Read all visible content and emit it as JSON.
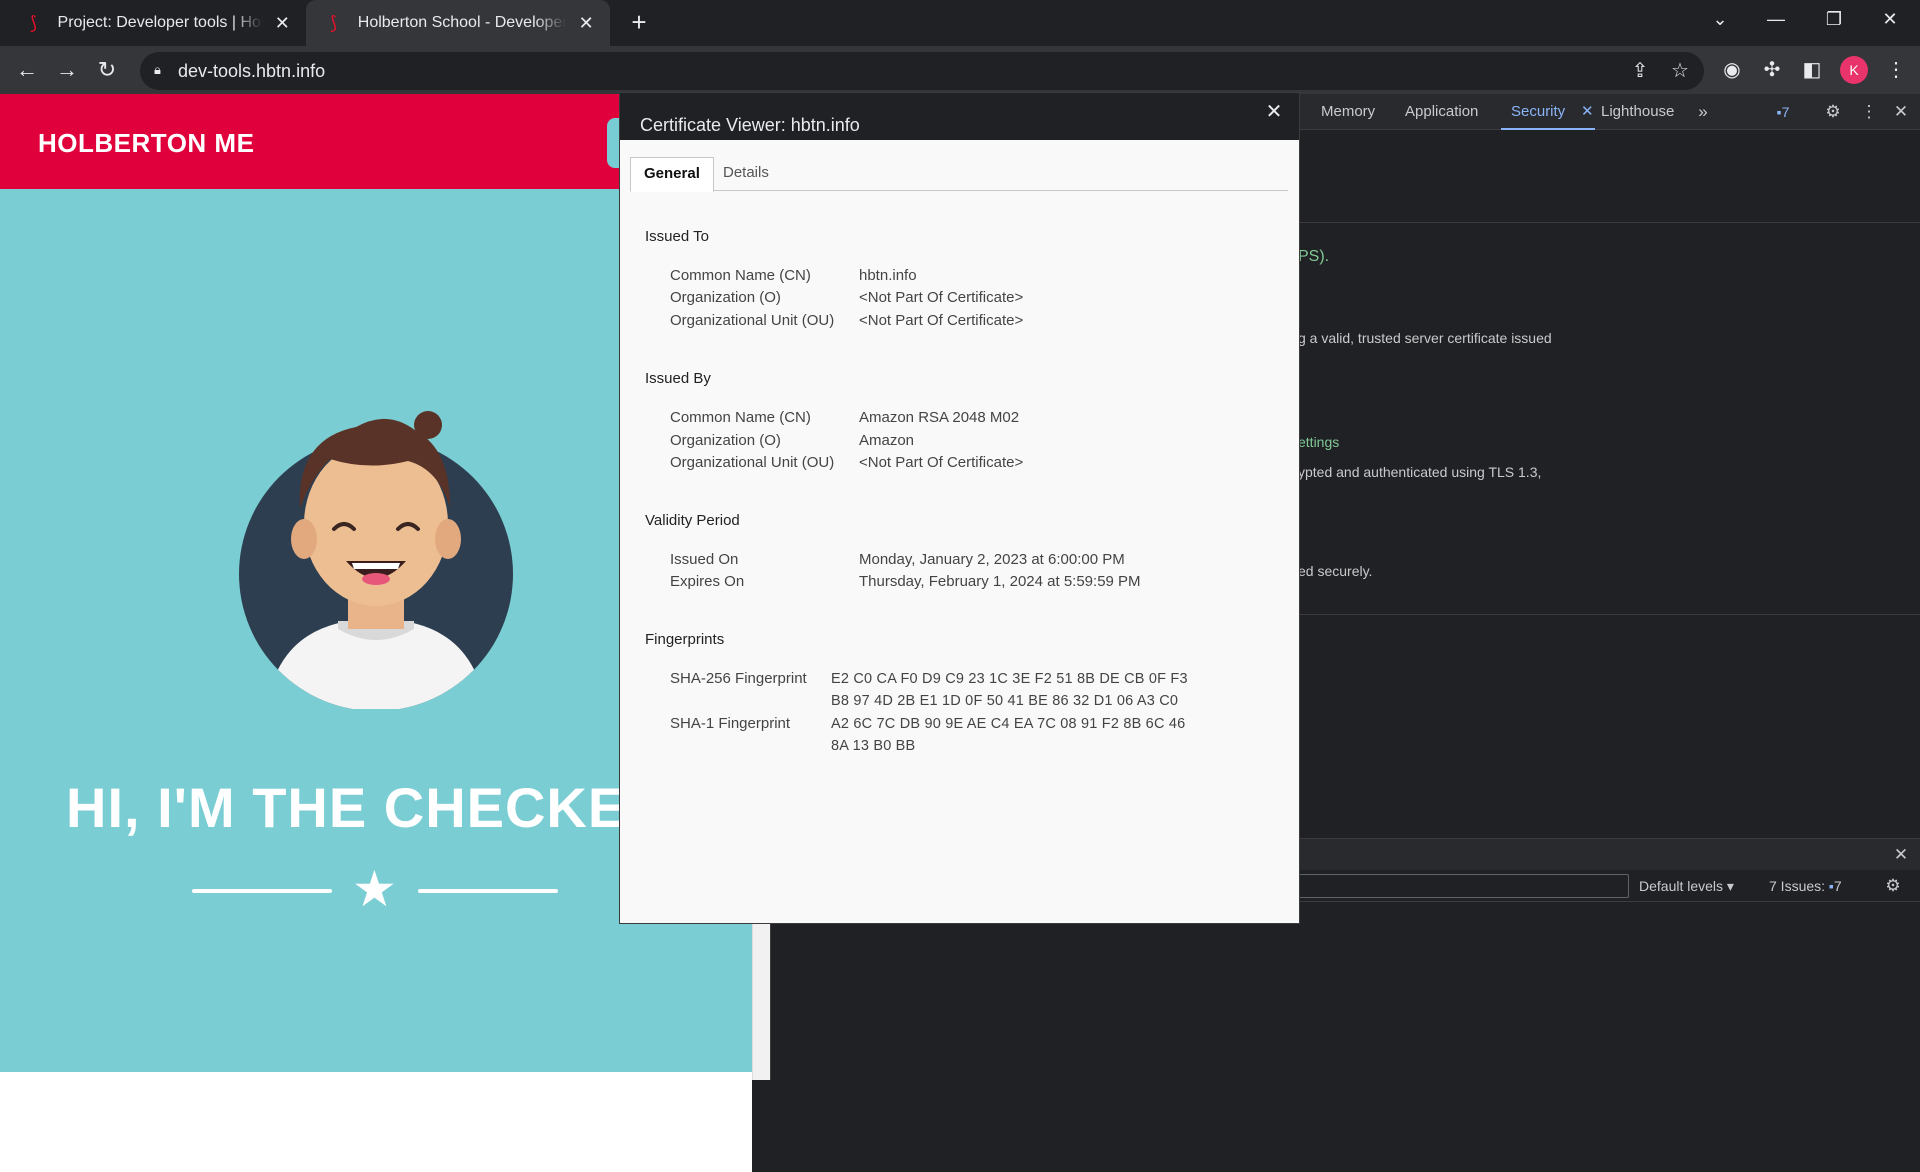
{
  "browser": {
    "tabs": [
      {
        "title": "Project: Developer tools | Holberton",
        "active": false
      },
      {
        "title": "Holberton School - Developer tools",
        "active": true
      }
    ],
    "url": "dev-tools.hbtn.info",
    "profile_initial": "K"
  },
  "page": {
    "brand": "HOLBERTON ME",
    "hero_heading": "HI, I'M THE CHECKE"
  },
  "devtools": {
    "tabs": [
      "Memory",
      "Application",
      "Security",
      "Lighthouse"
    ],
    "selected_tab": "Security",
    "issue_count": "7",
    "security_text": {
      "line1": "PS).",
      "line2": "g a valid, trusted server certificate issued",
      "line3": "ettings",
      "line4": "ypted and authenticated using TLS 1.3,",
      "line5": "ed securely."
    },
    "console": {
      "levels": "Default levels",
      "issues_label": "7 Issues:",
      "issues_count": "7"
    }
  },
  "certificate": {
    "title": "Certificate Viewer: hbtn.info",
    "tabs": [
      "General",
      "Details"
    ],
    "issued_to": {
      "heading": "Issued To",
      "rows": [
        {
          "label": "Common Name (CN)",
          "value": "hbtn.info"
        },
        {
          "label": "Organization (O)",
          "value": "<Not Part Of Certificate>"
        },
        {
          "label": "Organizational Unit (OU)",
          "value": "<Not Part Of Certificate>"
        }
      ]
    },
    "issued_by": {
      "heading": "Issued By",
      "rows": [
        {
          "label": "Common Name (CN)",
          "value": "Amazon RSA 2048 M02"
        },
        {
          "label": "Organization (O)",
          "value": "Amazon"
        },
        {
          "label": "Organizational Unit (OU)",
          "value": "<Not Part Of Certificate>"
        }
      ]
    },
    "validity": {
      "heading": "Validity Period",
      "rows": [
        {
          "label": "Issued On",
          "value": "Monday, January 2, 2023 at 6:00:00 PM"
        },
        {
          "label": "Expires On",
          "value": "Thursday, February 1, 2024 at 5:59:59 PM"
        }
      ]
    },
    "fingerprints": {
      "heading": "Fingerprints",
      "sha256_label": "SHA-256 Fingerprint",
      "sha256_line1": "E2 C0 CA F0 D9 C9 23 1C 3E F2 51 8B DE CB 0F F3",
      "sha256_line2": "B8 97 4D 2B E1 1D 0F 50 41 BE 86 32 D1 06 A3 C0",
      "sha1_label": "SHA-1 Fingerprint",
      "sha1_line1": "A2 6C 7C DB 90 9E AE C4 EA 7C 08 91 F2 8B 6C 46",
      "sha1_line2": "8A 13 B0 BB"
    }
  }
}
